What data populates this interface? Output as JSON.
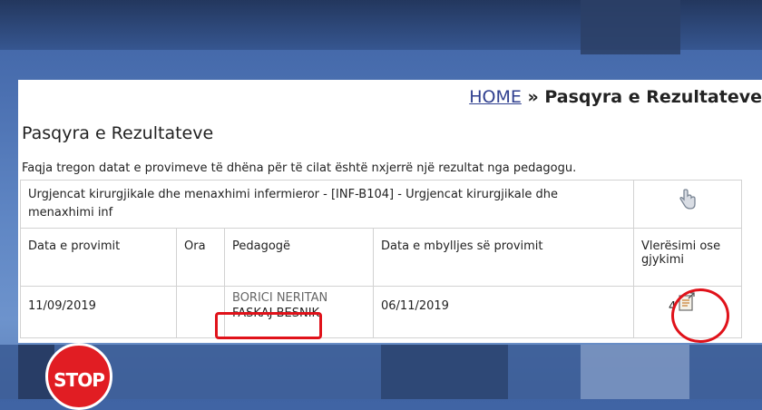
{
  "breadcrumb": {
    "home": "HOME",
    "separator": "»",
    "current": "Pasqyra e Rezultateve"
  },
  "page": {
    "title": "Pasqyra e Rezultateve",
    "description": "Faqja tregon datat e provimeve të dhëna për të cilat është nxjerrë një rezultat nga pedagogu."
  },
  "course": {
    "line1": "Urgjencat kirurgjikale dhe menaxhimi infermieror - [INF-B104] - Urgjencat kirurgjikale dhe",
    "line2": "menaxhimi inf"
  },
  "table": {
    "headers": [
      "Data e provimit",
      "Ora",
      "Pedagogë",
      "Data e mbylljes së provimit",
      "Vlerësimi ose gjykimi"
    ],
    "rows": [
      {
        "exam_date": "11/09/2019",
        "time": "",
        "lecturer_1": "BORICI NERITAN",
        "lecturer_2": "FASKAJ BESNIK",
        "close_date": "06/11/2019",
        "grade": "4"
      }
    ]
  },
  "icons": [
    "hand-pointer-icon",
    "document-icon"
  ],
  "overlay": {
    "logo_text": "STOP",
    "highlight_color": "#e0121a"
  }
}
